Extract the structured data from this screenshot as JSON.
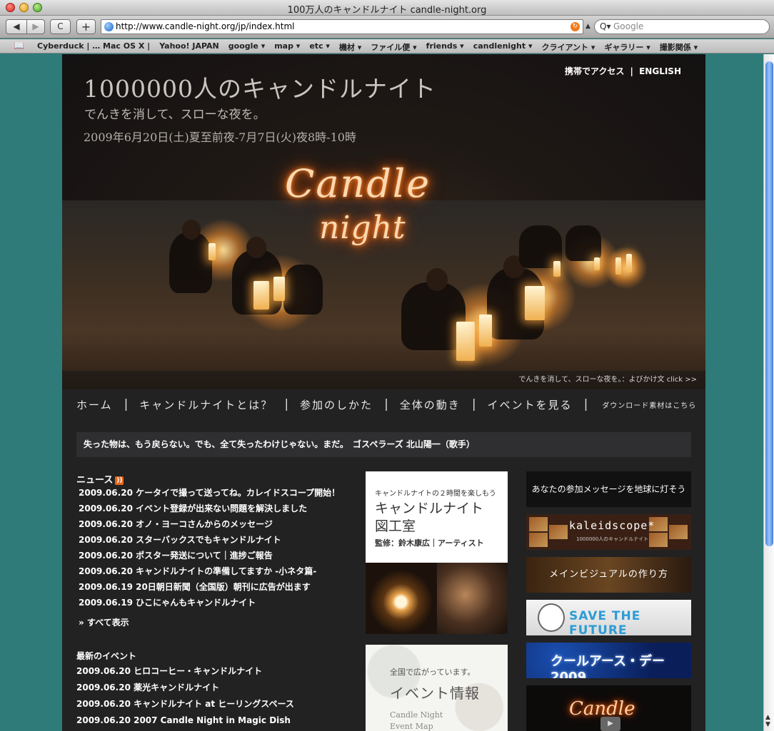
{
  "window": {
    "title": "100万人のキャンドルナイト candle-night.org"
  },
  "toolbar": {
    "back": "◀",
    "forward": "▶",
    "reload": "C",
    "add_tab": "+",
    "url": "http://www.candle-night.org/jp/index.html",
    "search_placeholder": "Google"
  },
  "bookmarks": [
    "Cyberduck | … Mac OS X |",
    "Yahoo! JAPAN",
    "google ▾",
    "map ▾",
    "etc ▾",
    "機材 ▾",
    "ファイル便 ▾",
    "friends ▾",
    "candlenight ▾",
    "クライアント ▾",
    "ギャラリー ▾",
    "撮影関係 ▾"
  ],
  "hero": {
    "title": "1000000人のキャンドルナイト",
    "subtitle": "でんきを消して、スローな夜を。",
    "date": "2009年6月20日(土)夏至前夜-7月7日(火)夜8時-10時",
    "mobile_link": "携帯でアクセス",
    "link_sep": "|",
    "english_link": "ENGLISH",
    "logo_line1": "Candle",
    "logo_line2": "night",
    "caption": "でんきを消して、スローな夜を。：よびかけ文 click >>"
  },
  "nav": {
    "items": [
      "ホーム",
      "キャンドルナイトとは？",
      "参加のしかた",
      "全体の動き",
      "イベントを見る"
    ],
    "separator": "|",
    "download": "ダウンロード素材はこちら"
  },
  "quote": "失った物は、もう戻らない。でも、全て失ったわけじゃない。まだ。　ゴスペラーズ 北山陽一（歌手）",
  "news": {
    "title": "ニュース",
    "feed": "))",
    "items": [
      "2009.06.20 ケータイで撮って送ってね。カレイドスコープ開始！",
      "2009.06.20 イベント登録が出来ない問題を解決しました",
      "2009.06.20 オノ・ヨーコさんからのメッセージ",
      "2009.06.20 スターバックスでもキャンドルナイト",
      "2009.06.20 ポスター発送について｜進捗ご報告",
      "2009.06.20 キャンドルナイトの準備してますか -小ネタ篇-",
      "2009.06.19 20日朝日新聞（全国版）朝刊に広告が出ます",
      "2009.06.19 ひこにゃんもキャンドルナイト"
    ],
    "show_all": "» すべて表示"
  },
  "events": {
    "title": "最新のイベント",
    "items": [
      "2009.06.20 ヒロコーヒー・キャンドルナイト",
      "2009.06.20 薬光キャンドルナイト",
      "2009.06.20 キャンドルナイト at ヒーリングスペース",
      "2009.06.20 2007 Candle Night in Magic Dish"
    ]
  },
  "cards": {
    "zukou": {
      "small": "キャンドルナイトの２時間を楽しもう",
      "line1": "キャンドルナイト",
      "line2": "図工室",
      "credit": "監修：鈴木康広｜アーティスト"
    },
    "map": {
      "small": "全国で広がっています。",
      "big": "イベント情報",
      "en1": "Candle Night",
      "en2": "Event Map"
    }
  },
  "banners": {
    "message": "あなたの参加メッセージを地球に灯そう",
    "kaleidoscope": "kaleidscope*",
    "kaleidoscope_sub": "1000000人のキャンドルナイト",
    "visual": "メインビジュアルの作り方",
    "save": "SAVE THE FUTURE",
    "cool": "クールアース・デー 2009",
    "video_logo": "Candle",
    "play": "▶"
  }
}
